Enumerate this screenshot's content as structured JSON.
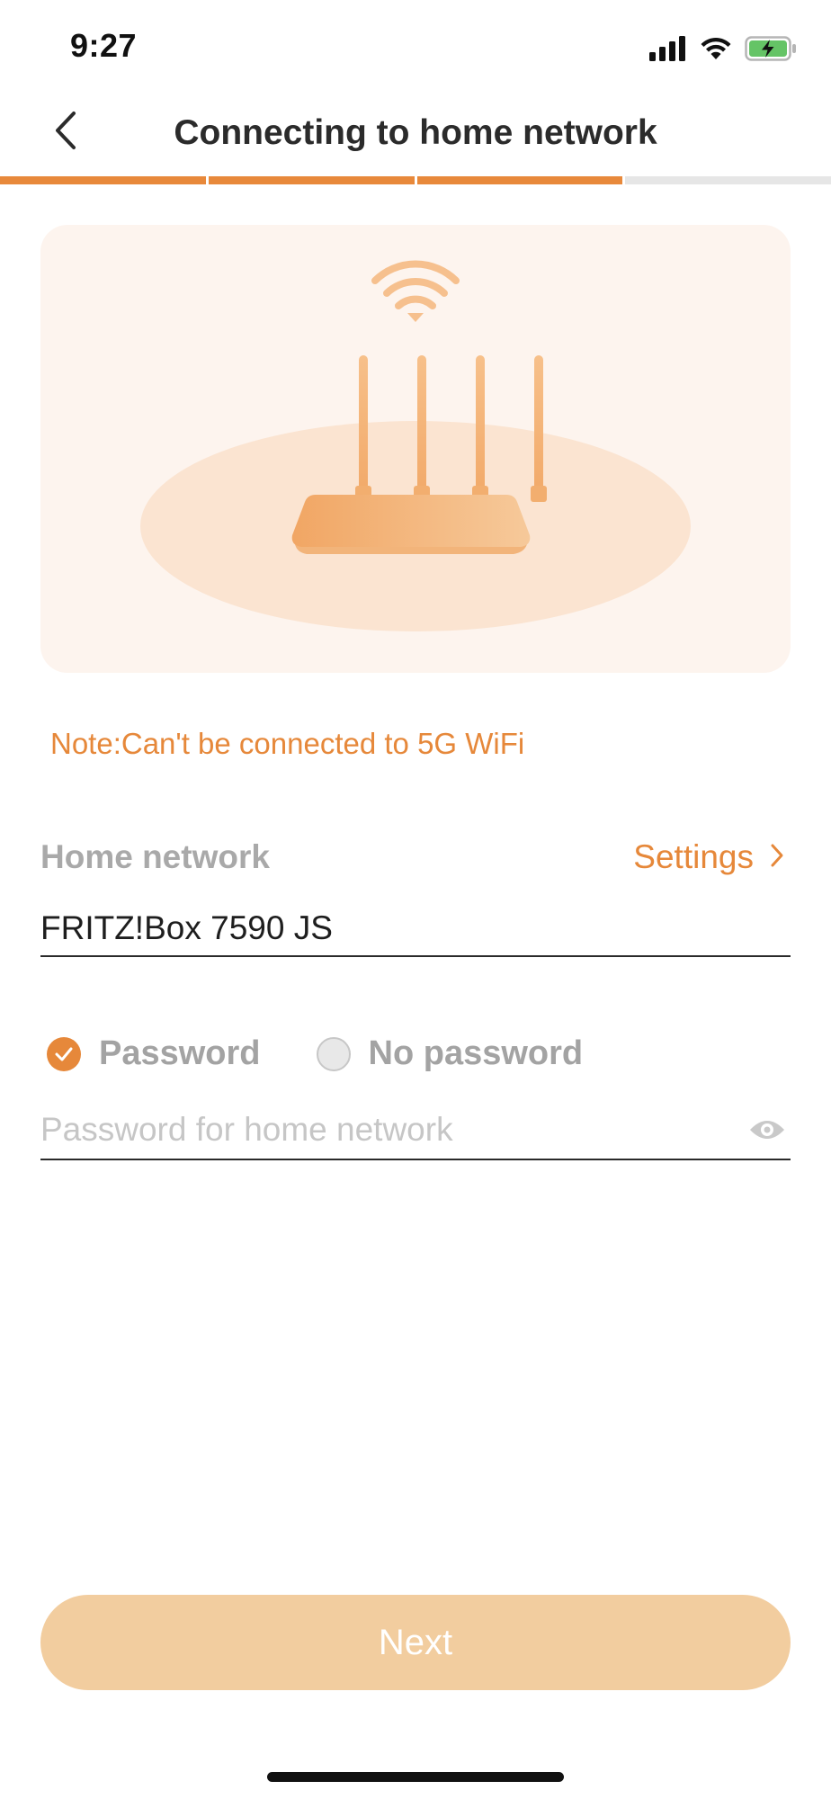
{
  "status_bar": {
    "time": "9:27",
    "icons": [
      "signal-icon",
      "wifi-icon",
      "battery-charging-icon"
    ]
  },
  "header": {
    "title": "Connecting to home network",
    "back_icon": "chevron-left-icon"
  },
  "progress": {
    "steps_total": 4,
    "steps_completed": 3
  },
  "illustration": {
    "subject": "router-with-wifi-signal",
    "icon": "router-icon"
  },
  "note": "Note:Can't be connected to 5G WiFi",
  "home_network": {
    "label": "Home network",
    "settings_label": "Settings",
    "settings_icon": "chevron-right-icon",
    "ssid": "FRITZ!Box 7590 JS"
  },
  "auth": {
    "options": [
      {
        "label": "Password",
        "selected": true
      },
      {
        "label": "No password",
        "selected": false
      }
    ],
    "password_placeholder": "Password for home network",
    "password_value": "",
    "toggle_visibility_icon": "eye-icon"
  },
  "next_button": {
    "label": "Next",
    "enabled": false
  },
  "colors": {
    "accent": "#e6883a",
    "progress_done": "#e8893b",
    "progress_todo": "#e6e6e6",
    "card_bg": "#fdf4ee",
    "button_disabled": "#f2cd9f",
    "muted_label": "#a9a9a9"
  }
}
